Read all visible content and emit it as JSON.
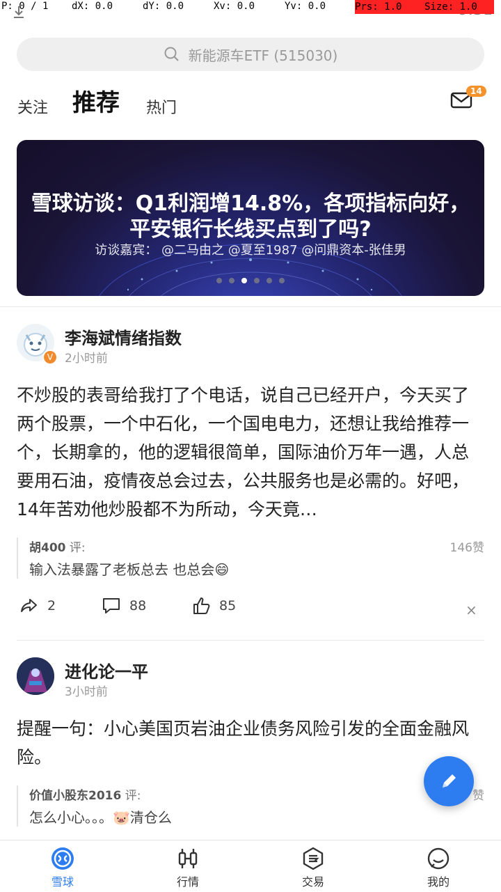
{
  "debug": {
    "p": "P: 0 / 1",
    "dx": "dX: 0.0",
    "dy": "dY: 0.0",
    "xv": "Xv: 0.0",
    "yv": "Yv: 0.0",
    "prs": "Prs: 1.0",
    "size": "Size: 1.0"
  },
  "status": {
    "time": "9:31"
  },
  "search": {
    "placeholder": "新能源车ETF (515030)"
  },
  "tabs": [
    {
      "label": "关注"
    },
    {
      "label": "推荐"
    },
    {
      "label": "热门"
    }
  ],
  "mail": {
    "badge": "14"
  },
  "banner": {
    "line1": "雪球访谈：Q1利润增14.8%，各项指标向好，",
    "line2": "平安银行长线买点到了吗?",
    "line3": "访谈嘉宾：  @二马由之 @夏至1987 @问鼎资本-张佳男",
    "active_dot": 2,
    "dot_count": 6
  },
  "posts": [
    {
      "author": "李海斌情绪指数",
      "time": "2小时前",
      "verified": "V",
      "body": "不炒股的表哥给我打了个电话，说自己已经开户，今天买了两个股票，一个中石化，一个国电电力，还想让我给推荐一个，长期拿的，他的逻辑很简单，国际油价万年一遇，人总要用石油，疫情夜总会过去，公共服务也是必需的。好吧，14年苦劝他炒股都不为所动，今天竟…",
      "comment": {
        "user": "胡400",
        "suffix": " 评:",
        "text": "输入法暴露了老板总去 也总会😄",
        "likes": "146赞"
      },
      "shares": "2",
      "comments": "88",
      "likes": "85",
      "close": "×"
    },
    {
      "author": "进化论一平",
      "time": "3小时前",
      "body": "提醒一句：小心美国页岩油企业债务风险引发的全面金融风险。",
      "comment": {
        "user": "价值小股东2016",
        "suffix": " 评:",
        "text": "怎么小心。。。🐷清仓么",
        "likes": "赞"
      }
    }
  ],
  "nav": [
    {
      "label": "雪球",
      "icon": "snowball-icon"
    },
    {
      "label": "行情",
      "icon": "candlestick-icon"
    },
    {
      "label": "交易",
      "icon": "trade-icon"
    },
    {
      "label": "我的",
      "icon": "profile-icon"
    }
  ],
  "colors": {
    "accent": "#2e7df0",
    "badge": "#f5922a",
    "debug_red": "#ff2222"
  }
}
